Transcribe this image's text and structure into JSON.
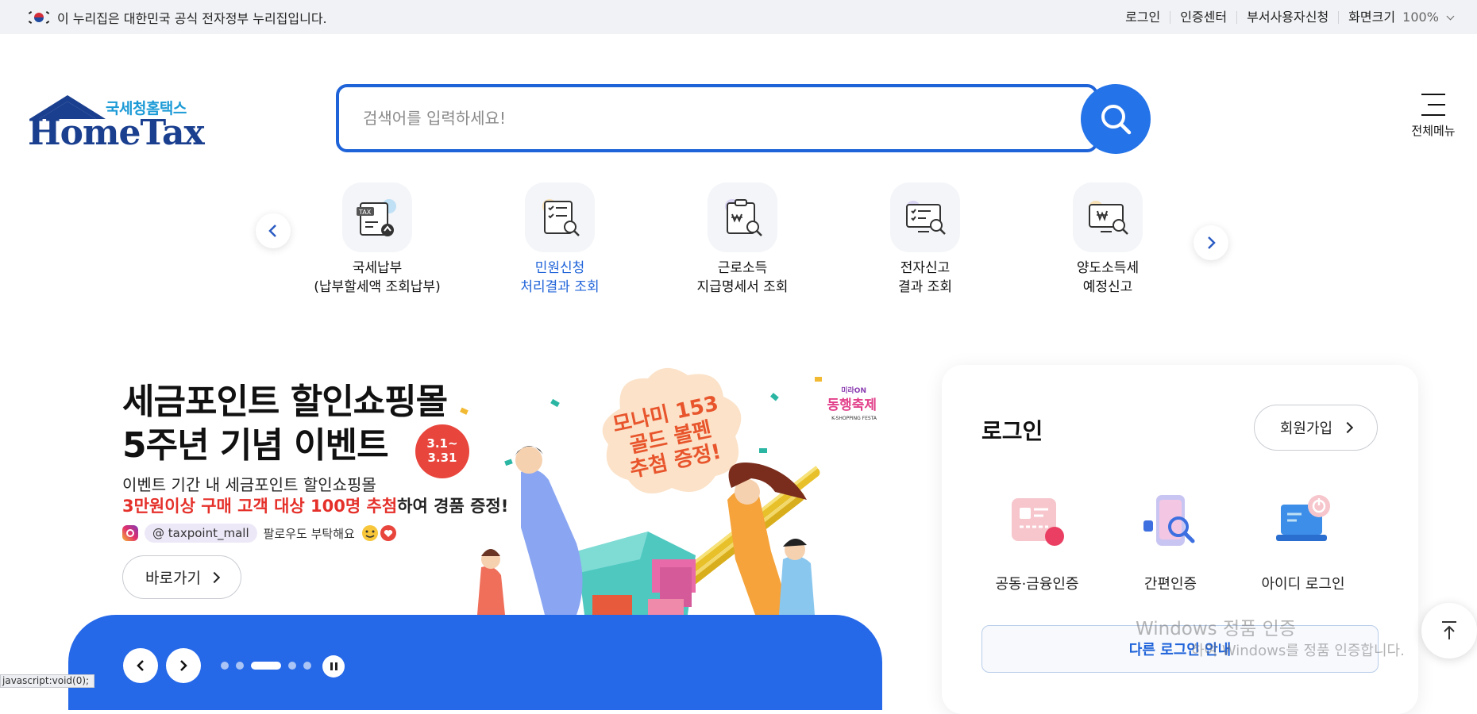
{
  "topbar": {
    "notice": "이 누리집은 대한민국 공식 전자정부 누리집입니다.",
    "links": [
      "로그인",
      "인증센터",
      "부서사용자신청"
    ],
    "zoom_label": "화면크기",
    "zoom_value": "100%"
  },
  "logo": {
    "sub": "국세청홈택스",
    "main": "HomeTax"
  },
  "search": {
    "placeholder": "검색어를 입력하세요!"
  },
  "all_menu": {
    "label": "전체메뉴"
  },
  "quick_menu": [
    {
      "line1": "국세납부",
      "line2": "(납부할세액 조회납부)",
      "icon": "tax-upload-icon"
    },
    {
      "line1": "민원신청",
      "line2": "처리결과 조회",
      "icon": "document-search-icon"
    },
    {
      "line1": "근로소득",
      "line2": "지급명세서 조회",
      "icon": "won-clipboard-search-icon"
    },
    {
      "line1": "전자신고",
      "line2": "결과 조회",
      "icon": "monitor-search-icon"
    },
    {
      "line1": "양도소득세",
      "line2": "예정신고",
      "icon": "monitor-won-search-icon"
    }
  ],
  "banner": {
    "title1": "세금포인트 할인쇼핑몰",
    "title2": "5주년 기념 이벤트",
    "badge": "3.1~\n3.31",
    "desc1": "이벤트 기간 내 세금포인트 할인쇼핑몰",
    "desc2_red": "3만원이상 구매 고객 대상 100명 추첨",
    "desc2_rest": "하여 경품 증정!",
    "instagram": "@ taxpoint_mall",
    "follow": "팔로우도 부탁해요",
    "go_button": "바로가기",
    "prize": "모나미 153\n골드 볼펜\n추첨 증정!",
    "festival": "동행축제",
    "festival_top": "미라ON",
    "festival_bottom": "K-SHOPPING FESTA",
    "active_dot": 3,
    "dot_count": 5
  },
  "login": {
    "title": "로그인",
    "join_button": "회원가입",
    "methods": [
      {
        "label": "공동·금융인증",
        "icon": "certificate-card-icon"
      },
      {
        "label": "간편인증",
        "icon": "phone-search-icon"
      },
      {
        "label": "아이디 로그인",
        "icon": "laptop-power-icon"
      }
    ],
    "other_button": "다른 로그인 안내"
  },
  "watermark": {
    "line1": "Windows 정품 인증",
    "line2": "하여 Windows를 정품 인증합니다."
  },
  "status_tip": "javascript:void(0);",
  "colors": {
    "accent": "#2473e8",
    "brand": "#1a3f8f",
    "sky": "#1b9ad6",
    "red": "#e5302a"
  }
}
